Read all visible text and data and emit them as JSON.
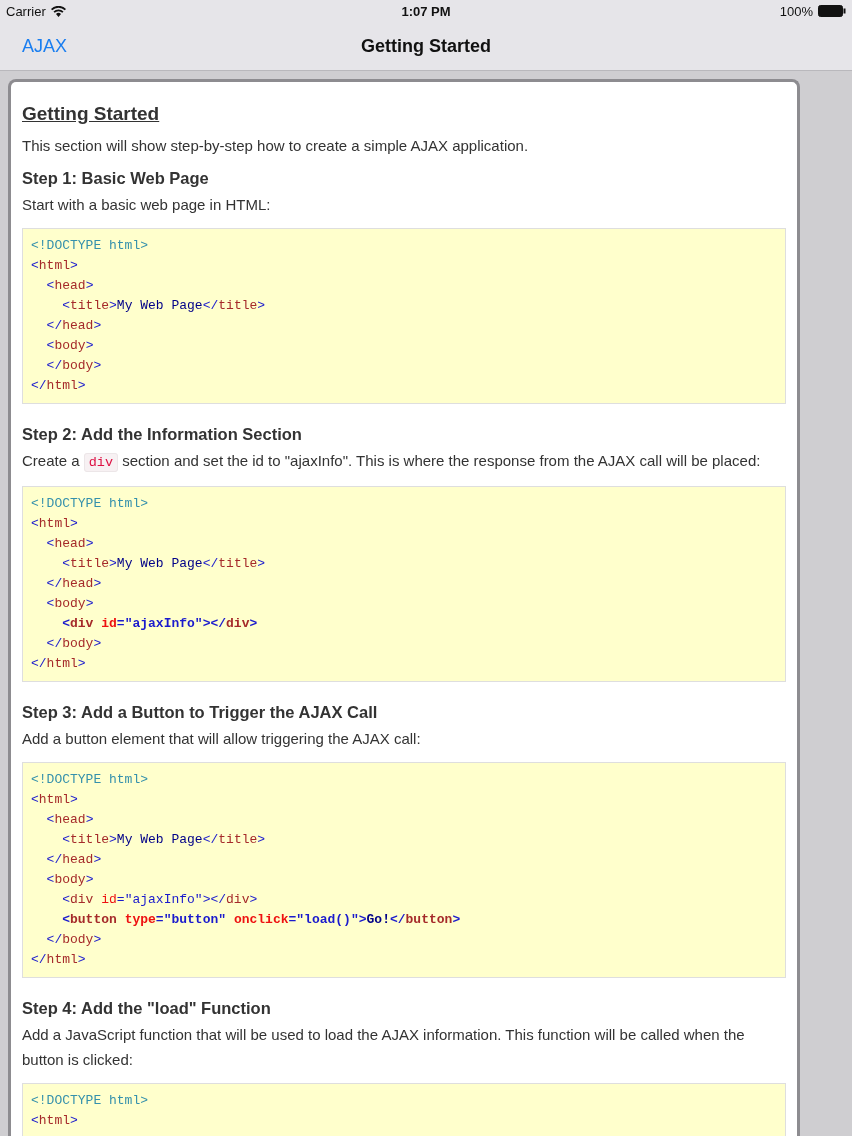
{
  "status_bar": {
    "carrier": "Carrier",
    "time": "1:07 PM",
    "battery": "100%"
  },
  "nav_bar": {
    "back": "AJAX",
    "title": "Getting Started"
  },
  "article": {
    "title": "Getting Started",
    "intro": "This section will show step-by-step how to create a simple AJAX application.",
    "steps": [
      {
        "heading": "Step 1: Basic Web Page",
        "text": [
          {
            "kind": "text",
            "text": "Start with a basic web page in HTML:"
          }
        ],
        "code": [
          {
            "bold": false,
            "tokens": [
              {
                "kind": "doctype",
                "text": "<!DOCTYPE html>"
              }
            ]
          },
          {
            "bold": false,
            "tokens": [
              {
                "kind": "punct",
                "text": "<"
              },
              {
                "kind": "tag",
                "text": "html"
              },
              {
                "kind": "punct",
                "text": ">"
              }
            ]
          },
          {
            "bold": false,
            "tokens": [
              {
                "kind": "punct",
                "text": "  <"
              },
              {
                "kind": "tag",
                "text": "head"
              },
              {
                "kind": "punct",
                "text": ">"
              }
            ]
          },
          {
            "bold": false,
            "tokens": [
              {
                "kind": "punct",
                "text": "    <"
              },
              {
                "kind": "tag",
                "text": "title"
              },
              {
                "kind": "punct",
                "text": ">"
              },
              {
                "kind": "text",
                "text": "My Web Page"
              },
              {
                "kind": "punct",
                "text": "</"
              },
              {
                "kind": "tag",
                "text": "title"
              },
              {
                "kind": "punct",
                "text": ">"
              }
            ]
          },
          {
            "bold": false,
            "tokens": [
              {
                "kind": "punct",
                "text": "  </"
              },
              {
                "kind": "tag",
                "text": "head"
              },
              {
                "kind": "punct",
                "text": ">"
              }
            ]
          },
          {
            "bold": false,
            "tokens": [
              {
                "kind": "punct",
                "text": "  <"
              },
              {
                "kind": "tag",
                "text": "body"
              },
              {
                "kind": "punct",
                "text": ">"
              }
            ]
          },
          {
            "bold": false,
            "tokens": [
              {
                "kind": "punct",
                "text": "  </"
              },
              {
                "kind": "tag",
                "text": "body"
              },
              {
                "kind": "punct",
                "text": ">"
              }
            ]
          },
          {
            "bold": false,
            "tokens": [
              {
                "kind": "punct",
                "text": "</"
              },
              {
                "kind": "tag",
                "text": "html"
              },
              {
                "kind": "punct",
                "text": ">"
              }
            ]
          }
        ]
      },
      {
        "heading": "Step 2: Add the Information Section",
        "text": [
          {
            "kind": "text",
            "text": "Create a "
          },
          {
            "kind": "code",
            "text": "div"
          },
          {
            "kind": "text",
            "text": " section and set the id to \"ajaxInfo\". This is where the response from the AJAX call will be placed:"
          }
        ],
        "code": [
          {
            "bold": false,
            "tokens": [
              {
                "kind": "doctype",
                "text": "<!DOCTYPE html>"
              }
            ]
          },
          {
            "bold": false,
            "tokens": [
              {
                "kind": "punct",
                "text": "<"
              },
              {
                "kind": "tag",
                "text": "html"
              },
              {
                "kind": "punct",
                "text": ">"
              }
            ]
          },
          {
            "bold": false,
            "tokens": [
              {
                "kind": "punct",
                "text": "  <"
              },
              {
                "kind": "tag",
                "text": "head"
              },
              {
                "kind": "punct",
                "text": ">"
              }
            ]
          },
          {
            "bold": false,
            "tokens": [
              {
                "kind": "punct",
                "text": "    <"
              },
              {
                "kind": "tag",
                "text": "title"
              },
              {
                "kind": "punct",
                "text": ">"
              },
              {
                "kind": "text",
                "text": "My Web Page"
              },
              {
                "kind": "punct",
                "text": "</"
              },
              {
                "kind": "tag",
                "text": "title"
              },
              {
                "kind": "punct",
                "text": ">"
              }
            ]
          },
          {
            "bold": false,
            "tokens": [
              {
                "kind": "punct",
                "text": "  </"
              },
              {
                "kind": "tag",
                "text": "head"
              },
              {
                "kind": "punct",
                "text": ">"
              }
            ]
          },
          {
            "bold": false,
            "tokens": [
              {
                "kind": "punct",
                "text": "  <"
              },
              {
                "kind": "tag",
                "text": "body"
              },
              {
                "kind": "punct",
                "text": ">"
              }
            ]
          },
          {
            "bold": true,
            "tokens": [
              {
                "kind": "punct",
                "text": "    <"
              },
              {
                "kind": "tag",
                "text": "div"
              },
              {
                "kind": "attr",
                "text": " id"
              },
              {
                "kind": "punct",
                "text": "="
              },
              {
                "kind": "value",
                "text": "\"ajaxInfo\""
              },
              {
                "kind": "punct",
                "text": "></"
              },
              {
                "kind": "tag",
                "text": "div"
              },
              {
                "kind": "punct",
                "text": ">"
              }
            ]
          },
          {
            "bold": false,
            "tokens": [
              {
                "kind": "punct",
                "text": "  </"
              },
              {
                "kind": "tag",
                "text": "body"
              },
              {
                "kind": "punct",
                "text": ">"
              }
            ]
          },
          {
            "bold": false,
            "tokens": [
              {
                "kind": "punct",
                "text": "</"
              },
              {
                "kind": "tag",
                "text": "html"
              },
              {
                "kind": "punct",
                "text": ">"
              }
            ]
          }
        ]
      },
      {
        "heading": "Step 3: Add a Button to Trigger the AJAX Call",
        "text": [
          {
            "kind": "text",
            "text": "Add a button element that will allow triggering the AJAX call:"
          }
        ],
        "code": [
          {
            "bold": false,
            "tokens": [
              {
                "kind": "doctype",
                "text": "<!DOCTYPE html>"
              }
            ]
          },
          {
            "bold": false,
            "tokens": [
              {
                "kind": "punct",
                "text": "<"
              },
              {
                "kind": "tag",
                "text": "html"
              },
              {
                "kind": "punct",
                "text": ">"
              }
            ]
          },
          {
            "bold": false,
            "tokens": [
              {
                "kind": "punct",
                "text": "  <"
              },
              {
                "kind": "tag",
                "text": "head"
              },
              {
                "kind": "punct",
                "text": ">"
              }
            ]
          },
          {
            "bold": false,
            "tokens": [
              {
                "kind": "punct",
                "text": "    <"
              },
              {
                "kind": "tag",
                "text": "title"
              },
              {
                "kind": "punct",
                "text": ">"
              },
              {
                "kind": "text",
                "text": "My Web Page"
              },
              {
                "kind": "punct",
                "text": "</"
              },
              {
                "kind": "tag",
                "text": "title"
              },
              {
                "kind": "punct",
                "text": ">"
              }
            ]
          },
          {
            "bold": false,
            "tokens": [
              {
                "kind": "punct",
                "text": "  </"
              },
              {
                "kind": "tag",
                "text": "head"
              },
              {
                "kind": "punct",
                "text": ">"
              }
            ]
          },
          {
            "bold": false,
            "tokens": [
              {
                "kind": "punct",
                "text": "  <"
              },
              {
                "kind": "tag",
                "text": "body"
              },
              {
                "kind": "punct",
                "text": ">"
              }
            ]
          },
          {
            "bold": false,
            "tokens": [
              {
                "kind": "punct",
                "text": "    <"
              },
              {
                "kind": "tag",
                "text": "div"
              },
              {
                "kind": "attr",
                "text": " id"
              },
              {
                "kind": "punct",
                "text": "="
              },
              {
                "kind": "value",
                "text": "\"ajaxInfo\""
              },
              {
                "kind": "punct",
                "text": "></"
              },
              {
                "kind": "tag",
                "text": "div"
              },
              {
                "kind": "punct",
                "text": ">"
              }
            ]
          },
          {
            "bold": true,
            "tokens": [
              {
                "kind": "punct",
                "text": "    <"
              },
              {
                "kind": "tag",
                "text": "button"
              },
              {
                "kind": "attr",
                "text": " type"
              },
              {
                "kind": "punct",
                "text": "="
              },
              {
                "kind": "value",
                "text": "\"button\""
              },
              {
                "kind": "attr",
                "text": " onclick"
              },
              {
                "kind": "punct",
                "text": "="
              },
              {
                "kind": "value",
                "text": "\"load()\""
              },
              {
                "kind": "punct",
                "text": ">"
              },
              {
                "kind": "text",
                "text": "Go!"
              },
              {
                "kind": "punct",
                "text": "</"
              },
              {
                "kind": "tag",
                "text": "button"
              },
              {
                "kind": "punct",
                "text": ">"
              }
            ]
          },
          {
            "bold": false,
            "tokens": [
              {
                "kind": "punct",
                "text": "  </"
              },
              {
                "kind": "tag",
                "text": "body"
              },
              {
                "kind": "punct",
                "text": ">"
              }
            ]
          },
          {
            "bold": false,
            "tokens": [
              {
                "kind": "punct",
                "text": "</"
              },
              {
                "kind": "tag",
                "text": "html"
              },
              {
                "kind": "punct",
                "text": ">"
              }
            ]
          }
        ]
      },
      {
        "heading": "Step 4: Add the \"load\" Function",
        "text": [
          {
            "kind": "text",
            "text": "Add a JavaScript function that will be used to load the AJAX information. This function will be called when the button is clicked:"
          }
        ],
        "code": [
          {
            "bold": false,
            "tokens": [
              {
                "kind": "doctype",
                "text": "<!DOCTYPE html>"
              }
            ]
          },
          {
            "bold": false,
            "tokens": [
              {
                "kind": "punct",
                "text": "<"
              },
              {
                "kind": "tag",
                "text": "html"
              },
              {
                "kind": "punct",
                "text": ">"
              }
            ]
          }
        ]
      }
    ]
  }
}
